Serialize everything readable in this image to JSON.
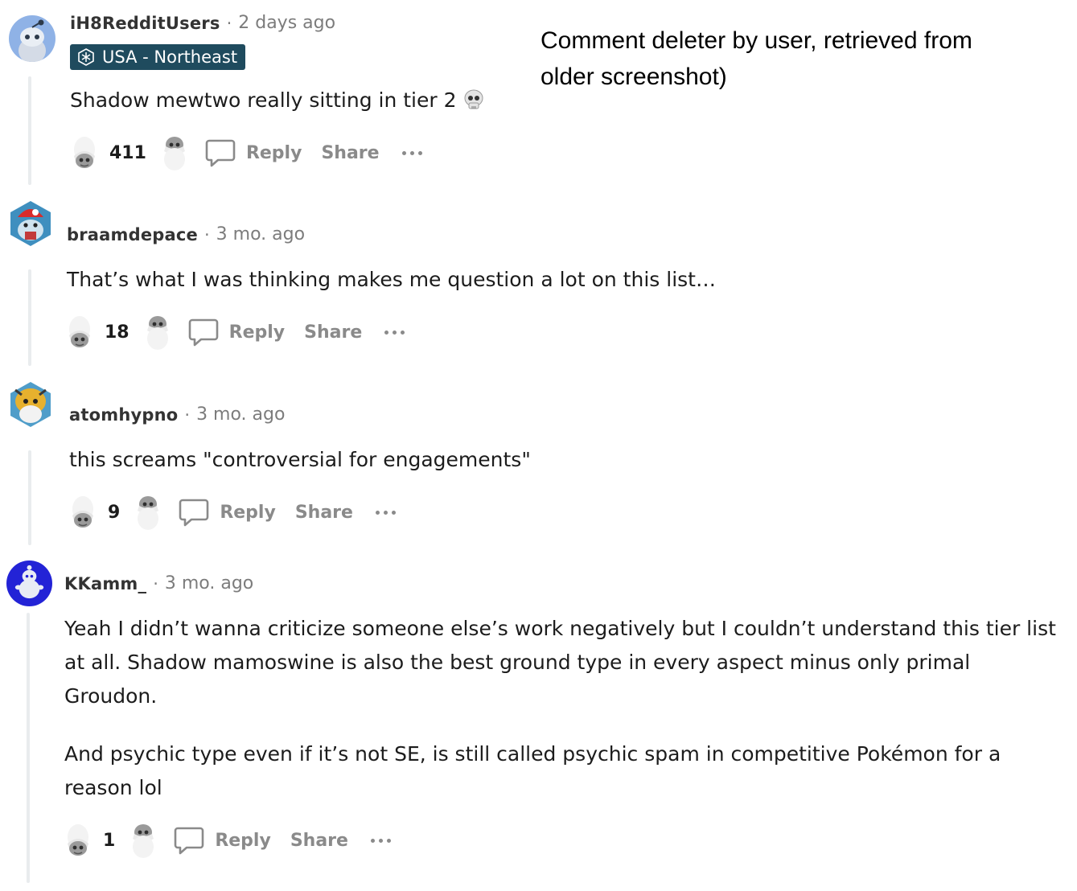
{
  "annotation": "Comment deleter by user, retrieved from older screenshot)",
  "actions": {
    "reply_label": "Reply",
    "share_label": "Share"
  },
  "comments": [
    {
      "username": "iH8RedditUsers",
      "time": "2 days ago",
      "flair": "USA - Northeast",
      "body": [
        "Shadow mewtwo really sitting in tier 2"
      ],
      "votes": "411",
      "avatar_color": "#8fb2e6"
    },
    {
      "username": "braamdepace",
      "time": "3 mo. ago",
      "body": [
        "That’s what I was thinking makes me question a lot on this list…"
      ],
      "votes": "18",
      "avatar_color": "#3f8fbf"
    },
    {
      "username": "atomhypno",
      "time": "3 mo. ago",
      "body": [
        "this screams \"controversial for engagements\""
      ],
      "votes": "9",
      "avatar_color": "#e7b12e"
    },
    {
      "username": "KKamm_",
      "time": "3 mo. ago",
      "body": [
        "Yeah I didn’t wanna criticize someone else’s work negatively but I couldn’t understand this tier list at all. Shadow mamoswine is also the best ground type in every aspect minus only primal Groudon.",
        "And psychic type even if it’s not SE, is still called psychic spam in competitive Pokémon for a reason lol"
      ],
      "votes": "1",
      "avatar_color": "#2323d6"
    }
  ]
}
